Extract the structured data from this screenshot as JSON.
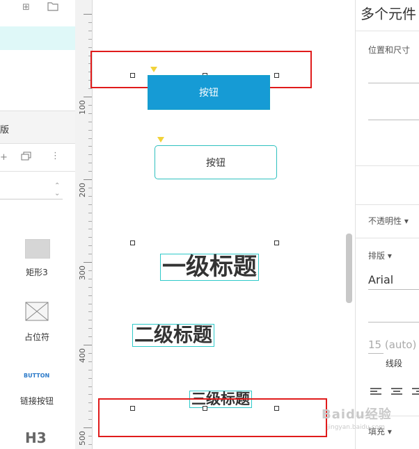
{
  "left_panel": {
    "section_label": "版",
    "library": [
      {
        "label": "矩形3",
        "icon": "rectangle-shape"
      },
      {
        "label": "占位符",
        "icon": "placeholder-box"
      },
      {
        "label": "链接按钮",
        "preview": "BUTTON"
      },
      {
        "label": "",
        "preview": "H3"
      }
    ]
  },
  "ruler": {
    "labels": [
      "100",
      "200",
      "300",
      "400",
      "500"
    ]
  },
  "canvas": {
    "button_primary": "按钮",
    "button_secondary": "按钮",
    "heading1": "一级标题",
    "heading2": "二级标题",
    "heading3": "三级标题"
  },
  "right_panel": {
    "title": "多个元件",
    "position_size_label": "位置和尺寸",
    "opacity_label": "不透明性",
    "typography_label": "排版",
    "font_family": "Arial",
    "line_spacing_value": "15 (auto)",
    "line_label": "线段",
    "fill_label": "填充"
  },
  "watermark": {
    "text": "Baidu经验",
    "sub": "jingyan.baidu.com"
  },
  "colors": {
    "primary_button": "#169bd5",
    "selection_highlight": "#e01b1b",
    "element_outline": "#2ec9c9",
    "selected_row": "#dff8f8"
  }
}
